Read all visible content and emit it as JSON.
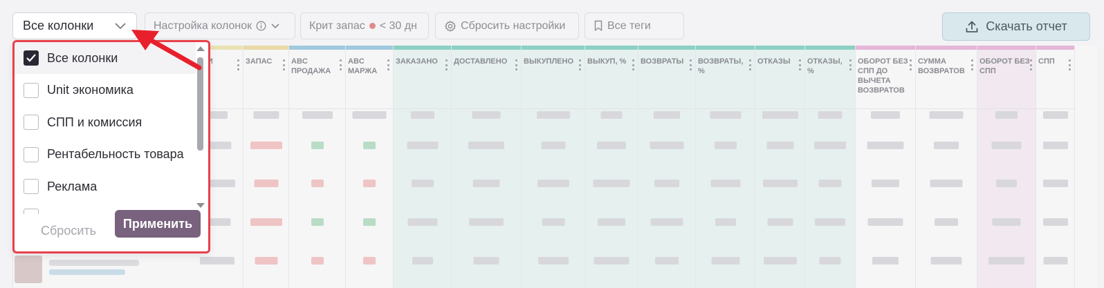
{
  "toolbar": {
    "columns_select": {
      "value": "Все колонки",
      "icon": "chevron-down-icon"
    },
    "column_settings": {
      "label": "Настройка колонок",
      "icons": [
        "info-icon",
        "chevron-down-icon"
      ]
    },
    "critical_stock": {
      "label": "Крит запас",
      "condition": "< 30 дн",
      "dot_color": "#e08a8a"
    },
    "reset_settings": {
      "label": "Сбросить настройки",
      "icon": "gear-icon"
    },
    "all_tags": {
      "label": "Все теги",
      "icon": "bookmark-icon"
    },
    "download": {
      "label": "Скачать отчет",
      "icon": "upload-icon"
    }
  },
  "dropdown": {
    "options": [
      {
        "label": "Все колонки",
        "checked": true
      },
      {
        "label": "Unit экономика",
        "checked": false
      },
      {
        "label": "СПП и комиссия",
        "checked": false
      },
      {
        "label": "Рентабельность товара",
        "checked": false
      },
      {
        "label": "Реклама",
        "checked": false
      }
    ],
    "reset_label": "Сбросить",
    "apply_label": "Применить"
  },
  "table": {
    "columns": [
      {
        "label": "АТКИ",
        "band": "#e9e3b4"
      },
      {
        "label": "ЗАПАС",
        "band": "#e9d9a6"
      },
      {
        "label": "ABC ПРОДАЖА",
        "band": "#9fc9de"
      },
      {
        "label": "ABC МАРЖА",
        "band": "#9fc9de"
      },
      {
        "label": "ЗАКАЗАНО",
        "band": "#8cd0c4"
      },
      {
        "label": "ДОСТАВЛЕНО",
        "band": "#8cd0c4"
      },
      {
        "label": "ВЫКУПЛЕНО",
        "band": "#8cd0c4"
      },
      {
        "label": "ВЫКУП, %",
        "band": "#8cd0c4"
      },
      {
        "label": "ВОЗВРАТЫ",
        "band": "#8cd0c4"
      },
      {
        "label": "ВОЗВРАТЫ, %",
        "band": "#8cd0c4"
      },
      {
        "label": "ОТКАЗЫ",
        "band": "#8cd0c4"
      },
      {
        "label": "ОТКАЗЫ, %",
        "band": "#8cd0c4"
      },
      {
        "label": "ОБОРОТ БЕЗ СПП ДО ВЫЧЕТА ВОЗВРАТОВ",
        "band": "#e5b6d8"
      },
      {
        "label": "СУММА ВОЗВРАТОВ",
        "band": "#e5b6d8"
      },
      {
        "label": "ОБОРОТ БЕЗ СПП",
        "band": "#e5b6d8"
      },
      {
        "label": "СПП",
        "band": "#e5b6d8"
      }
    ]
  }
}
